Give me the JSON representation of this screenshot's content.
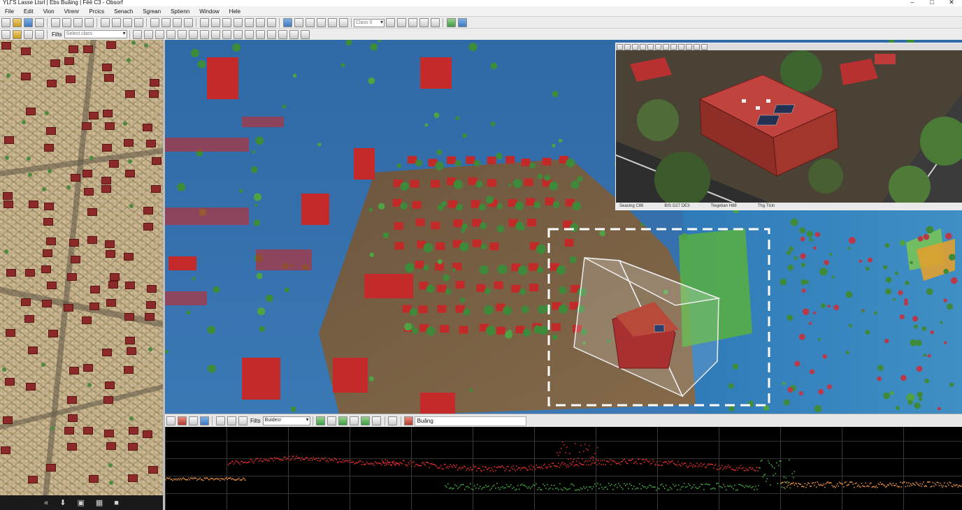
{
  "window": {
    "title": "ΥLΓS Lasse Ltsrl | Ebs Buăing | Fēē C3 - Obsorf",
    "controls": [
      "–",
      "□",
      "✕"
    ]
  },
  "menu": [
    "File",
    "Edit",
    "Vion",
    "Vtrenr",
    "Prcics",
    "Senach",
    "Sgrean",
    "Sptienn",
    "Window",
    "Hele"
  ],
  "toolbar": {
    "dropdown_value": "Class 0",
    "filters_label": "Filts",
    "filters_value": "Select class"
  },
  "left_panel": {
    "footer_icons": [
      "rewind-icon",
      "down-arrow-icon",
      "layers-icon",
      "grid-icon",
      "stop-icon"
    ],
    "footer_glyphs": [
      "«",
      "⬇",
      "▣",
      "▦",
      "■"
    ]
  },
  "inset": {
    "status": [
      "Seasing C88",
      "BIS G27 DE3",
      "Tlegetian H88",
      "Thg Tlcln"
    ]
  },
  "profile_toolbar": {
    "filter_label": "Filts",
    "filter_value": "Buidecr",
    "class_value": "Buăng"
  },
  "colors": {
    "water": "#3570ad",
    "ground": "#7a5a3a",
    "building": "#c22a2a",
    "vegetation": "#3f8a3a",
    "selection": "#ffffff",
    "profile_high": "#d32b2b",
    "profile_ground": "#e08a3a",
    "profile_veg": "#3fae3f"
  }
}
